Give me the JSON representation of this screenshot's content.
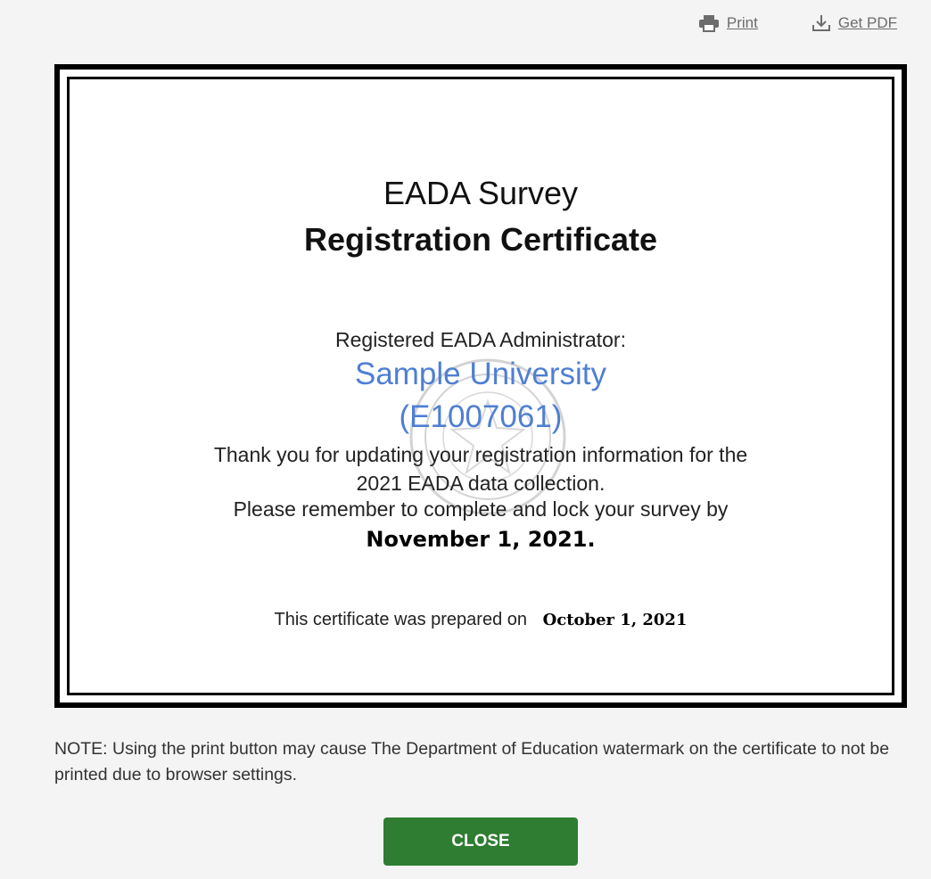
{
  "toolbar": {
    "print_label": "Print",
    "pdf_label": "Get PDF",
    "print_icon": "printer-icon",
    "pdf_icon": "download-icon"
  },
  "certificate": {
    "title": "EADA Survey",
    "subtitle": "Registration Certificate",
    "admin_label": "Registered EADA Administrator:",
    "institution_name": "Sample University",
    "institution_id": "(E1007061)",
    "thanks_line1": "Thank you for updating your registration information for the",
    "thanks_line2": "2021 EADA data collection.",
    "reminder": "Please remember to complete and lock your survey by",
    "deadline": "November 1, 2021.",
    "prepared_label": "This certificate was prepared on",
    "prepared_date": "October 1, 2021",
    "watermark": "department-of-education-seal"
  },
  "note": "NOTE: Using the print button may cause The Department of Education watermark on the certificate to not be printed due to browser settings.",
  "close_label": "CLOSE",
  "colors": {
    "accent_blue": "#4f7fd3",
    "close_green": "#2e7d32"
  }
}
